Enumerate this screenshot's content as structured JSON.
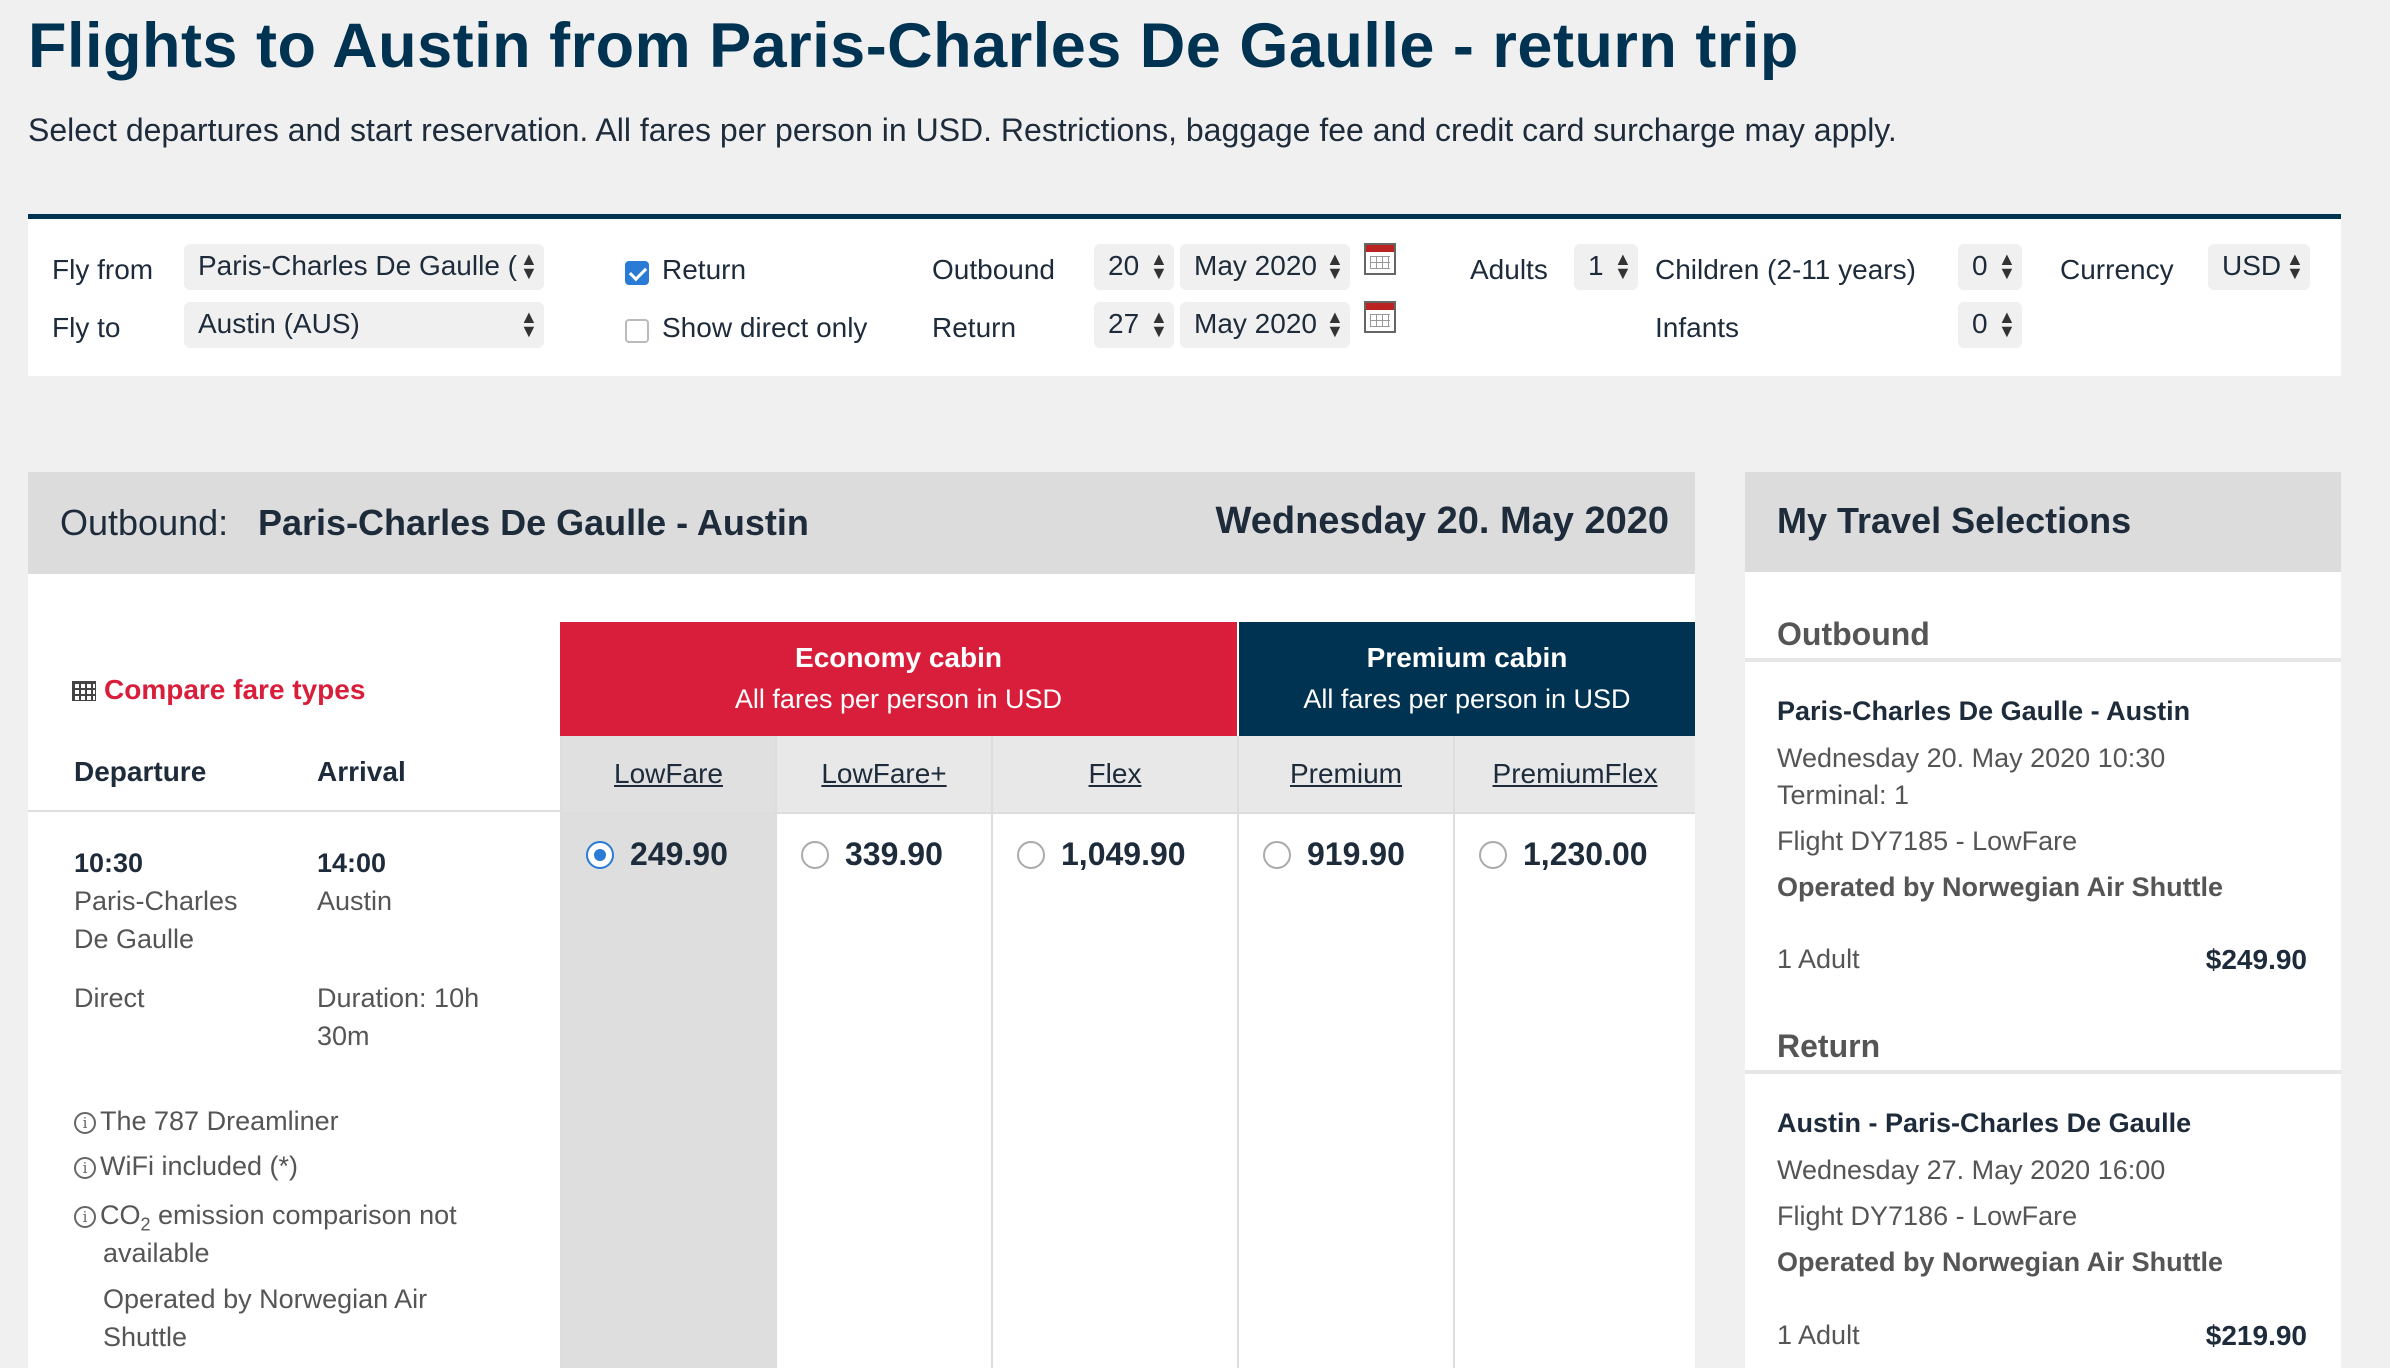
{
  "page": {
    "title": "Flights to Austin from Paris-Charles De Gaulle - return trip",
    "subtitle": "Select departures and start reservation. All fares per person in USD. Restrictions, baggage fee and credit card surcharge may apply."
  },
  "search": {
    "fly_from_label": "Fly from",
    "fly_from_value": "Paris-Charles De Gaulle (",
    "fly_to_label": "Fly to",
    "fly_to_value": "Austin (AUS)",
    "return_label": "Return",
    "return_checked": true,
    "direct_label": "Show direct only",
    "direct_checked": false,
    "outbound_label": "Outbound",
    "outbound_day": "20",
    "outbound_month": "May 2020",
    "return_date_label": "Return",
    "return_day": "27",
    "return_month": "May 2020",
    "adults_label": "Adults",
    "adults_value": "1",
    "children_label": "Children (2-11 years)",
    "children_value": "0",
    "infants_label": "Infants",
    "infants_value": "0",
    "currency_label": "Currency",
    "currency_value": "USD"
  },
  "outbound": {
    "label": "Outbound:",
    "route": "Paris-Charles De Gaulle - Austin",
    "date": "Wednesday 20. May 2020",
    "compare_link": "Compare fare types",
    "departure_header": "Departure",
    "arrival_header": "Arrival",
    "economy": {
      "title": "Economy cabin",
      "subtitle": "All fares per person in USD"
    },
    "premium": {
      "title": "Premium cabin",
      "subtitle": "All fares per person in USD"
    },
    "fares": [
      {
        "name": "LowFare",
        "price": "249.90",
        "selected": true
      },
      {
        "name": "LowFare+",
        "price": "339.90",
        "selected": false
      },
      {
        "name": "Flex",
        "price": "1,049.90",
        "selected": false
      },
      {
        "name": "Premium",
        "price": "919.90",
        "selected": false
      },
      {
        "name": "PremiumFlex",
        "price": "1,230.00",
        "selected": false
      }
    ],
    "flight": {
      "dep_time": "10:30",
      "dep_place_1": "Paris-Charles",
      "dep_place_2": "De Gaulle",
      "arr_time": "14:00",
      "arr_place": "Austin",
      "stops": "Direct",
      "duration_1": "Duration: 10h",
      "duration_2": "30m",
      "aircraft": "The 787 Dreamliner",
      "wifi": "WiFi included (*)",
      "co2_prefix": "CO",
      "co2_sub": "2",
      "co2_suffix": " emission comparison not",
      "co2_line2": "available",
      "operated_1": "Operated by Norwegian Air",
      "operated_2": "Shuttle"
    }
  },
  "selections": {
    "title": "My Travel Selections",
    "outbound": {
      "heading": "Outbound",
      "route": "Paris-Charles De Gaulle - Austin",
      "datetime": "Wednesday 20. May 2020 10:30",
      "terminal": "Terminal: 1",
      "flight": "Flight DY7185 - LowFare",
      "operated": "Operated by Norwegian Air Shuttle",
      "pax": "1 Adult",
      "price": "$249.90"
    },
    "return": {
      "heading": "Return",
      "route": "Austin - Paris-Charles De Gaulle",
      "datetime": "Wednesday 27. May 2020 16:00",
      "flight": "Flight DY7186 - LowFare",
      "operated": "Operated by Norwegian Air Shuttle",
      "pax": "1 Adult",
      "price": "$219.90"
    }
  },
  "colors": {
    "navy": "#003251",
    "red": "#d81e3a",
    "radio_blue": "#2a7bd5"
  }
}
